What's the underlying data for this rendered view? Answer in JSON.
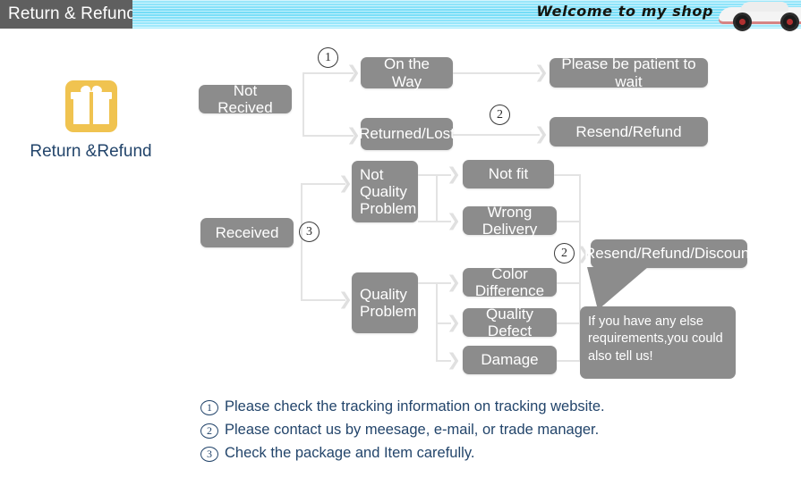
{
  "header": {
    "tab_title": "Return & Refund",
    "welcome_text": "Welcome to my shop",
    "band_color": "#72dcf7",
    "tab_color": "#5f5f5f"
  },
  "gift": {
    "label": "Return &Refund",
    "icon_name": "gift-icon",
    "icon_color": "#f0c350"
  },
  "flow": {
    "node_color": "#8c8c8c",
    "line_color": "#e3e3e3",
    "nodes": {
      "not_recived": "Not Recived",
      "on_the_way": "On the Way",
      "returned_lost": "Returned/Lost",
      "please_wait": "Please be patient to wait",
      "resend_refund": "Resend/Refund",
      "received": "Received",
      "not_quality_problem": "Not\nQuality\nProblem",
      "quality_problem": "Quality\nProblem",
      "not_fit": "Not fit",
      "wrong_delivery": "Wrong Delivery",
      "color_difference": "Color Difference",
      "quality_defect": "Quality Defect",
      "damage": "Damage",
      "resend_refund_discount": "Resend/Refund/Discount"
    },
    "markers": {
      "m1": "1",
      "m2_top": "2",
      "m3": "3",
      "m2_right": "2"
    },
    "bubble": "If you have any else requirements,you could also tell us!"
  },
  "notes": {
    "text_color": "#23456b",
    "items": [
      {
        "num": "1",
        "text": "Please check the tracking information on tracking website."
      },
      {
        "num": "2",
        "text": "Please contact us by meesage, e-mail, or trade manager."
      },
      {
        "num": "3",
        "text": "Check the package and Item carefully."
      }
    ]
  }
}
